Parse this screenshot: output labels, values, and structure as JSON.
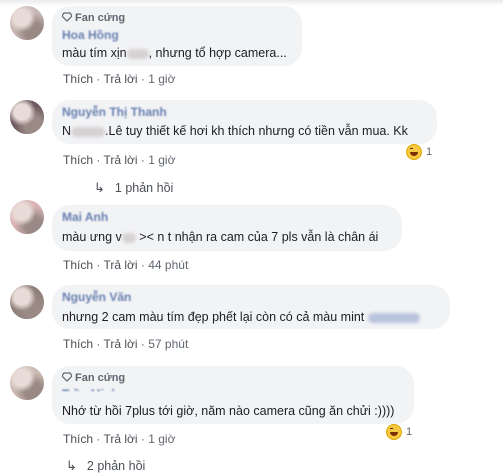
{
  "comments": [
    {
      "badge": "Fan cứng",
      "author": "Hoa Hồng",
      "text_before": "màu tím xịn",
      "text_after": ", nhưng tổ hợp camera...",
      "like": "Thích",
      "reply": "Trả lời",
      "time": "1 giờ"
    },
    {
      "author": "Nguyễn Thị Thanh",
      "text_before": "N",
      "text_after": ".Lê tuy thiết kế hơi kh thích nhưng có tiền vẫn mua. Kk",
      "like": "Thích",
      "reply": "Trả lời",
      "time": "1 giờ",
      "reaction_count": "1",
      "replies_label": "1 phản hồi"
    },
    {
      "author": "Mai Anh",
      "text_before": "màu ưng v",
      "text_after": " >< n t nhận ra cam của 7 pls vẫn là chân ái",
      "like": "Thích",
      "reply": "Trả lời",
      "time": "44 phút"
    },
    {
      "author": "Nguyễn Văn",
      "text_before": "nhưng 2 cam màu tím đẹp phết lại còn có cả màu mint",
      "text_after": "",
      "like": "Thích",
      "reply": "Trả lời",
      "time": "57 phút"
    },
    {
      "badge": "Fan cứng",
      "author": "Trần Minh",
      "text_before": "Nhớ từ hồi 7plus tới giờ, năm nào camera cũng ăn chửi :))))",
      "text_after": "",
      "like": "Thích",
      "reply": "Trả lời",
      "time": "1 giờ",
      "reaction_count": "1",
      "replies_label": "2 phản hồi"
    }
  ],
  "icons": {
    "badge": "diamond-icon",
    "reaction": "haha-emoji-icon",
    "reply_arrow": "reply-arrow-icon"
  },
  "colors": {
    "bubble": "#f2f3f5",
    "link": "#385898",
    "meta": "#606770"
  }
}
